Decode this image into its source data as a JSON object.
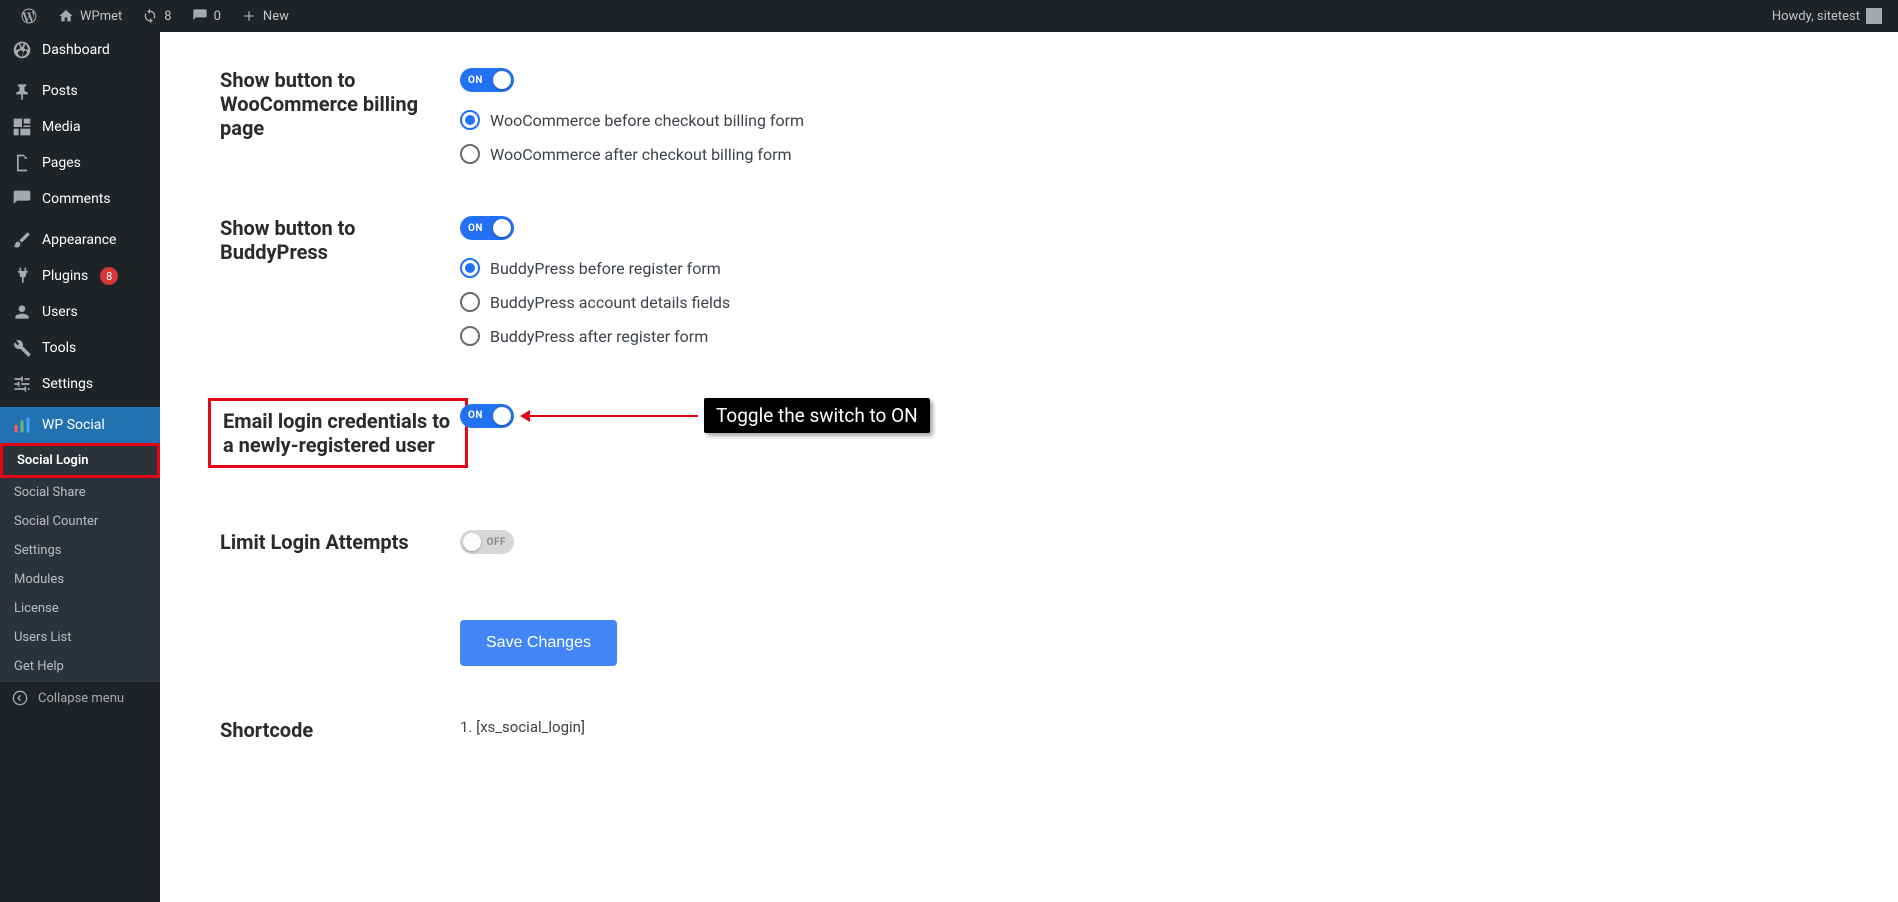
{
  "adminbar": {
    "site_name": "WPmet",
    "updates": "8",
    "comments": "0",
    "new_label": "New",
    "howdy": "Howdy, sitetest"
  },
  "sidebar": {
    "dashboard": "Dashboard",
    "posts": "Posts",
    "media": "Media",
    "pages": "Pages",
    "comments": "Comments",
    "appearance": "Appearance",
    "plugins": "Plugins",
    "plugins_badge": "8",
    "users": "Users",
    "tools": "Tools",
    "settings": "Settings",
    "wp_social": "WP Social",
    "sub_social_login": "Social Login",
    "sub_social_share": "Social Share",
    "sub_social_counter": "Social Counter",
    "sub_settings": "Settings",
    "sub_modules": "Modules",
    "sub_license": "License",
    "sub_users_list": "Users List",
    "sub_get_help": "Get Help",
    "collapse": "Collapse menu"
  },
  "settings": {
    "woo_label": "Show button to WooCommerce billing page",
    "woo_toggle": "ON",
    "woo_opt1": "WooCommerce before checkout billing form",
    "woo_opt2": "WooCommerce after checkout billing form",
    "bp_label": "Show button to BuddyPress",
    "bp_toggle": "ON",
    "bp_opt1": "BuddyPress before register form",
    "bp_opt2": "BuddyPress account details fields",
    "bp_opt3": "BuddyPress after register form",
    "email_label": "Email login credentials to a newly-registered user",
    "email_toggle": "ON",
    "limit_label": "Limit Login Attempts",
    "limit_toggle": "OFF",
    "save_btn": "Save Changes",
    "shortcode_label": "Shortcode",
    "shortcode_value": "1. [xs_social_login]"
  },
  "annotation": "Toggle the switch to ON"
}
